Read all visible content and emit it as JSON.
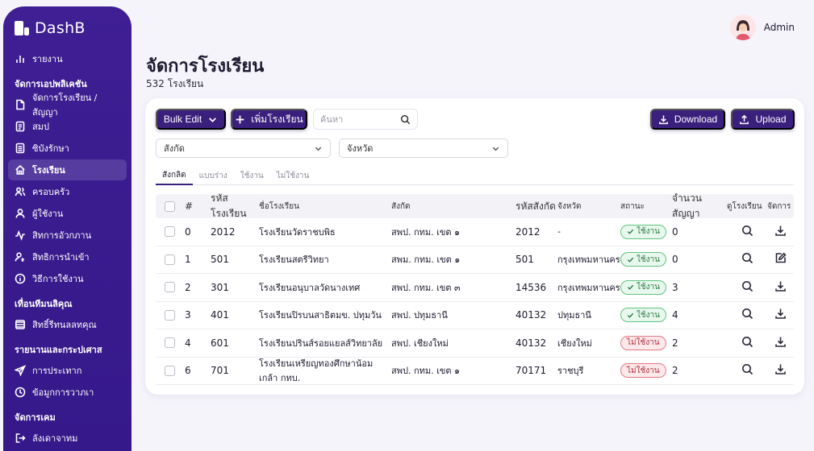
{
  "app": {
    "name": "DashB"
  },
  "user": {
    "name": "Admin"
  },
  "sidebar": {
    "items": [
      {
        "type": "item",
        "label": "รายงาน",
        "icon": "bar-chart-icon"
      },
      {
        "type": "section",
        "label": "จัดการเอปพลิเคชัน"
      },
      {
        "type": "item",
        "label": "จัดการโรงเรียน / สัญญา",
        "icon": "file-icon"
      },
      {
        "type": "item",
        "label": "สมป",
        "icon": "document-icon"
      },
      {
        "type": "item",
        "label": "ซิบังรักษา",
        "icon": "list-doc-icon"
      },
      {
        "type": "item",
        "label": "โรงเรียน",
        "icon": "home-icon",
        "active": true
      },
      {
        "type": "item",
        "label": "ครอบครัว",
        "icon": "users-icon"
      },
      {
        "type": "item",
        "label": "ผู้ใช้งาน",
        "icon": "user-icon"
      },
      {
        "type": "item",
        "label": "สิทการอัวกภาน",
        "icon": "activity-icon"
      },
      {
        "type": "item",
        "label": "สิทธิการนำเข้า",
        "icon": "user-key-icon"
      },
      {
        "type": "item",
        "label": "วิธีการใช้งาน",
        "icon": "info-icon"
      },
      {
        "type": "section",
        "label": "เทื่อนทีมนลิคุณ"
      },
      {
        "type": "item",
        "label": "สิทธิ์รีทนลลทคุณ",
        "icon": "layers-icon"
      },
      {
        "type": "section",
        "label": "รายนานและกระปเศาส"
      },
      {
        "type": "item",
        "label": "การประเทาก",
        "icon": "send-icon"
      },
      {
        "type": "item",
        "label": "ข้อมูกการวาภเา",
        "icon": "clock-icon"
      },
      {
        "type": "section",
        "label": "จัดการเคม"
      },
      {
        "type": "item",
        "label": "ลังเดาจาทม",
        "icon": "logout-icon"
      }
    ]
  },
  "page": {
    "title": "จัดการโรงเรียน",
    "subtitle": "532 โรงเรียน"
  },
  "toolbar": {
    "bulk_edit": "Bulk Edit",
    "add_school": "เพิ่มโรงเรียน",
    "search_placeholder": "ค้นหา",
    "download": "Download",
    "upload": "Upload"
  },
  "filters": {
    "affiliation": "สังกัด",
    "province": "จังหวัด"
  },
  "tabs": [
    "สังกลิด",
    "แบบร่าง",
    "ใช้งาน",
    "ไม่ใช้งาน"
  ],
  "table": {
    "headers": [
      "#",
      "รหัสโรงเรียน",
      "ชื่อโรงเรียน",
      "สังกัด",
      "รหัสสังกัด",
      "จังหวัด",
      "สถานะ",
      "จำนวนสัญญา",
      "ดูโรงเรียน",
      "จัดการ"
    ],
    "rows": [
      {
        "idx": "0",
        "code": "2012",
        "name": "โรงเรียนวัดราชบพิธ",
        "affiliation": "สพป. กทม. เขต ๑",
        "aff_code": "2012",
        "province": "-",
        "status": "ใช้งาน",
        "status_type": "ok",
        "contracts": "0",
        "action_icon": "download-icon"
      },
      {
        "idx": "1",
        "code": "501",
        "name": "โรงเรียนสตรีวิทยา",
        "affiliation": "สพม. กทม. เขต ๑",
        "aff_code": "501",
        "province": "กรุงเทพมหานคร",
        "status": "ใช้งาน",
        "status_type": "ok",
        "contracts": "0",
        "action_icon": "edit-icon"
      },
      {
        "idx": "2",
        "code": "301",
        "name": "โรงเรียนอนุบาลวัดนางเทศ",
        "affiliation": "สพป. กทม. เขต ๓",
        "aff_code": "14536",
        "province": "กรุงเทพมหานคร",
        "status": "ใช้งาน",
        "status_type": "ok",
        "contracts": "3",
        "action_icon": "download-icon"
      },
      {
        "idx": "3",
        "code": "401",
        "name": "โรงเรียนปิรบนสาธิตมข. ปทุมวัน",
        "affiliation": "สพป. ปทุมธานี",
        "aff_code": "40132",
        "province": "ปทุมธานี",
        "status": "ใช้งาน",
        "status_type": "ok",
        "contracts": "4",
        "action_icon": "download-icon"
      },
      {
        "idx": "4",
        "code": "601",
        "name": "โรงเรียนปรินส์รอยแยลส์วิทยาลัย",
        "affiliation": "สพป. เชียงใหม่",
        "aff_code": "40132",
        "province": "เชียงใหม่",
        "status": "ไม่ใช้งาน",
        "status_type": "bad",
        "contracts": "2",
        "action_icon": "download-icon"
      },
      {
        "idx": "6",
        "code": "701",
        "name": "โรงเรียนเหรียญทองศึกษาน้อมเกล้า กทบ.",
        "affiliation": "สพป. กทม. เขต ๑",
        "aff_code": "70171",
        "province": "ราชบุรี",
        "status": "ไม่ใช้งาน",
        "status_type": "bad",
        "contracts": "2",
        "action_icon": "download-icon"
      }
    ]
  },
  "colors": {
    "sidebar": "#3b1b8e",
    "primary_button": "#3b1f7d",
    "ok": "#5fc47e",
    "bad": "#e37a86"
  }
}
